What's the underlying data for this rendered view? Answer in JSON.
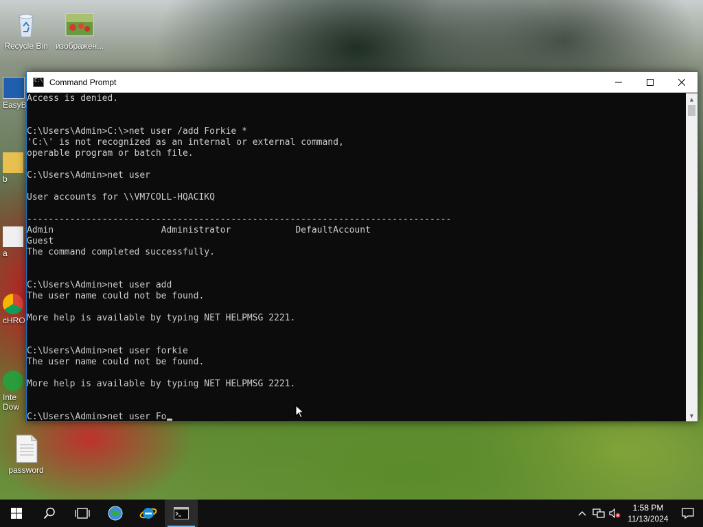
{
  "desktop": {
    "icons": [
      {
        "label": "Recycle Bin",
        "icon": "recycle-bin-icon"
      },
      {
        "label": "изображен...",
        "icon": "image-file-icon"
      },
      {
        "label": "password",
        "icon": "text-file-icon"
      }
    ],
    "partial_labels": [
      "EasyB",
      "b",
      "a",
      "cHRO",
      "Inte",
      "Dow"
    ]
  },
  "window": {
    "title": "Command Prompt",
    "icon": "cmd-icon",
    "controls": {
      "minimize": "minimize-icon",
      "maximize": "maximize-icon",
      "close": "close-icon"
    }
  },
  "console": {
    "lines": [
      "Access is denied.",
      "",
      "",
      "C:\\Users\\Admin>C:\\>net user /add Forkie *",
      "'C:\\' is not recognized as an internal or external command,",
      "operable program or batch file.",
      "",
      "C:\\Users\\Admin>net user",
      "",
      "User accounts for \\\\VM7COLL-HQACIKQ",
      "",
      "-------------------------------------------------------------------------------",
      "Admin                    Administrator            DefaultAccount",
      "Guest",
      "The command completed successfully.",
      "",
      "",
      "C:\\Users\\Admin>net user add",
      "The user name could not be found.",
      "",
      "More help is available by typing NET HELPMSG 2221.",
      "",
      "",
      "C:\\Users\\Admin>net user forkie",
      "The user name could not be found.",
      "",
      "More help is available by typing NET HELPMSG 2221.",
      "",
      ""
    ],
    "current_input": "C:\\Users\\Admin>net user Fo"
  },
  "taskbar": {
    "buttons": [
      {
        "name": "start-button",
        "icon": "windows-logo-icon"
      },
      {
        "name": "search-button",
        "icon": "search-icon"
      },
      {
        "name": "task-view-button",
        "icon": "task-view-icon"
      },
      {
        "name": "taskbar-app-browser",
        "icon": "globe-icon"
      },
      {
        "name": "taskbar-app-ie",
        "icon": "internet-explorer-icon"
      },
      {
        "name": "taskbar-app-cmd",
        "icon": "cmd-icon"
      }
    ],
    "tray": {
      "time": "1:58 PM",
      "date": "11/13/2024"
    }
  }
}
